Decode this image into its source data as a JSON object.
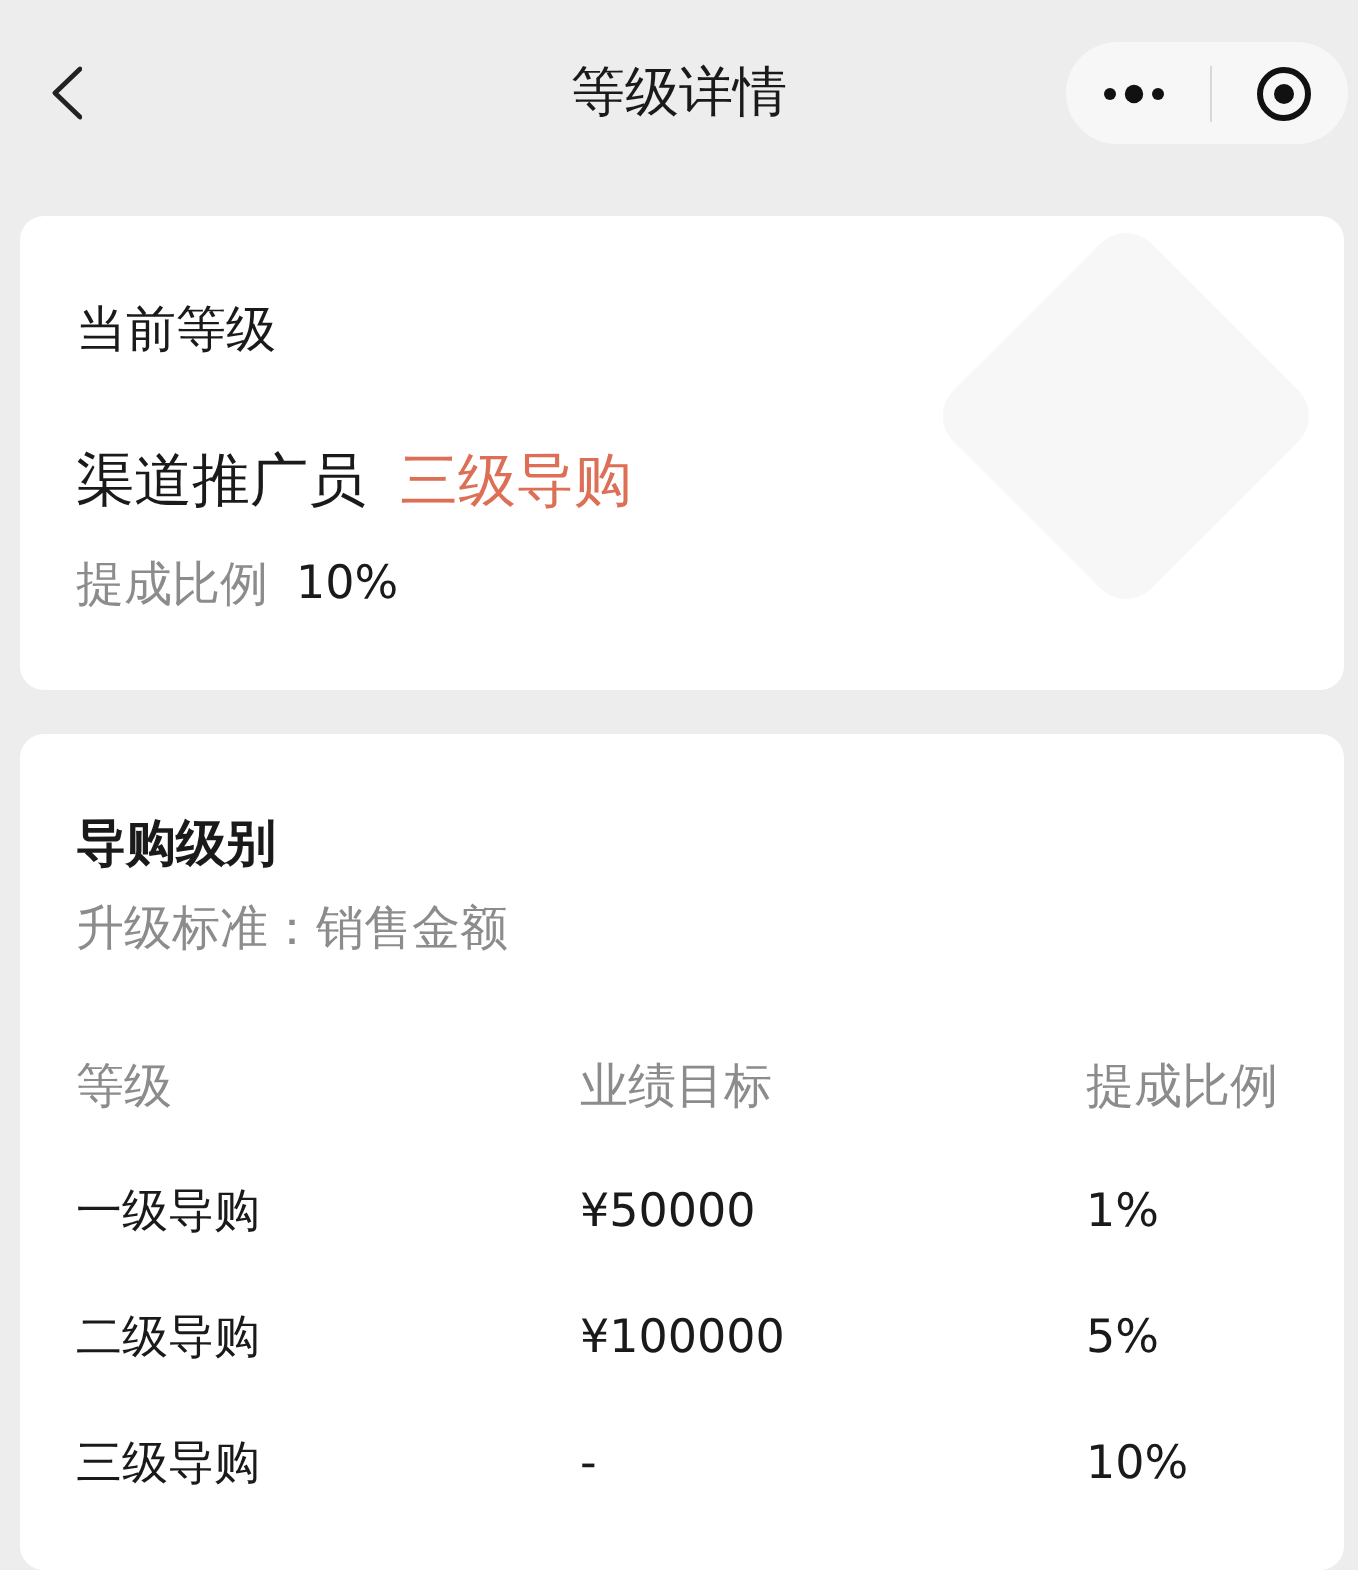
{
  "nav": {
    "title": "等级详情"
  },
  "current_level": {
    "heading": "当前等级",
    "role": "渠道推广员",
    "level": "三级导购",
    "commission_label": "提成比例",
    "commission_value": "10%"
  },
  "levels": {
    "heading": "导购级别",
    "criterion": "升级标准：销售金额",
    "table": {
      "columns": [
        "等级",
        "业绩目标",
        "提成比例"
      ],
      "rows": [
        [
          "一级导购",
          "¥50000",
          "1%"
        ],
        [
          "二级导购",
          "¥100000",
          "5%"
        ],
        [
          "三级导购",
          "-",
          "10%"
        ]
      ]
    }
  }
}
